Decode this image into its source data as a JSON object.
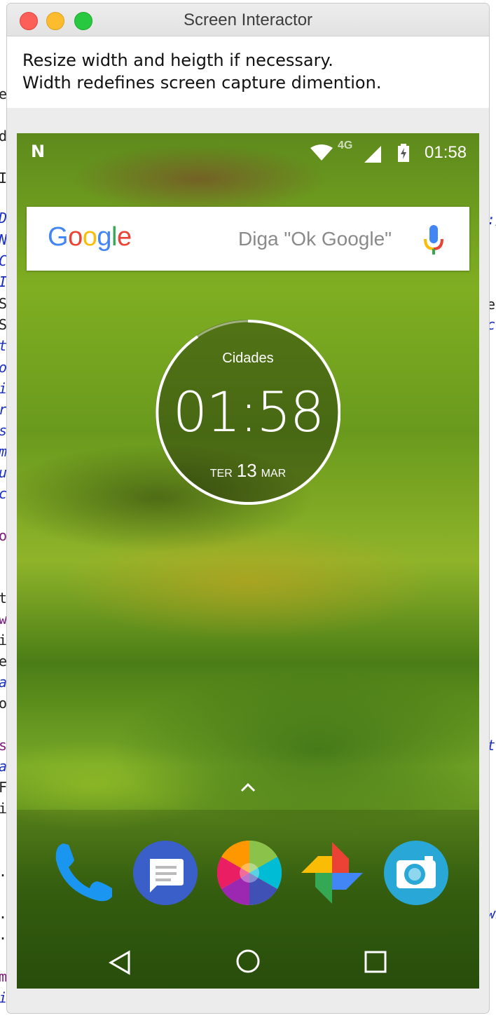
{
  "window": {
    "title": "Screen Interactor",
    "instructions": [
      "Resize width and heigth if necessary.",
      "Width redefines screen capture dimention."
    ]
  },
  "background_code": {
    "left_chars": [
      "e",
      "d",
      "I",
      "D",
      "N",
      "C",
      "I",
      "S",
      "S",
      "t",
      "o",
      "i",
      "r",
      "s",
      "m",
      "u",
      "c",
      "o",
      "t",
      "w",
      "i",
      "e",
      "a",
      "o",
      "s",
      "a",
      "F",
      "i",
      ".",
      ".",
      ".",
      "m",
      "i"
    ],
    "right_chars": [
      ":/",
      "ec",
      "cu",
      "te",
      "wi"
    ]
  },
  "statusbar": {
    "network_type": "4G",
    "time": "01:58",
    "notification_glyph": "N"
  },
  "search_widget": {
    "logo": [
      "G",
      "o",
      "o",
      "g",
      "l",
      "e"
    ],
    "hint": "Diga \"Ok Google\""
  },
  "clock_widget": {
    "city_label": "Cidades",
    "time": "01:58",
    "weekday": "TER",
    "day": "13",
    "month": "MAR"
  },
  "dock": {
    "apps": [
      "phone",
      "messages",
      "gallery",
      "photos",
      "camera"
    ]
  },
  "colors": {
    "google_blue": "#4285f4",
    "google_red": "#ea4335",
    "google_yellow": "#fbbc05",
    "google_green": "#34a853",
    "traffic_close": "#fc5f57",
    "traffic_minimize": "#fdbc2e",
    "traffic_maximize": "#28c840"
  }
}
